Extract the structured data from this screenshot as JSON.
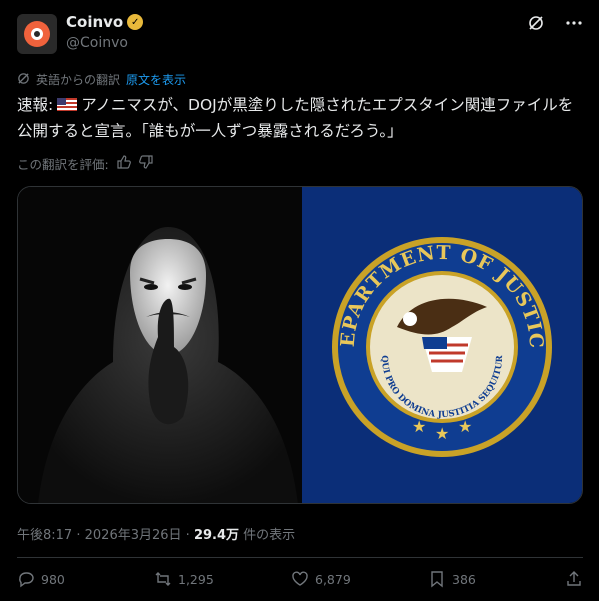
{
  "author": {
    "name": "Coinvo",
    "handle": "@Coinvo",
    "verified_mark": "✓"
  },
  "translation": {
    "label": "英語からの翻訳",
    "show_original": "原文を表示"
  },
  "tweet": {
    "prefix": "速報:",
    "text": "アノニマスが、DOJが黒塗りした隠されたエプスタイン関連ファイルを公開すると宣言。「誰もが一人ずつ暴露されるだろう。」"
  },
  "rate_translation": {
    "label": "この翻訳を評価:"
  },
  "seal": {
    "top_text": "DEPARTMENT OF JUSTICE",
    "motto": "QUI PRO DOMINA JUSTITIA SEQUITUR"
  },
  "meta": {
    "time": "午後8:17",
    "dot": "·",
    "date": "2026年3月26日",
    "views": "29.4万",
    "views_label": "件の表示"
  },
  "actions": {
    "replies": "980",
    "reposts": "1,295",
    "likes": "6,879",
    "bookmarks": "386"
  },
  "colors": {
    "accent": "#1d9bf0",
    "badge": "#e8b93b",
    "seal_bg": "#0b2e78"
  }
}
